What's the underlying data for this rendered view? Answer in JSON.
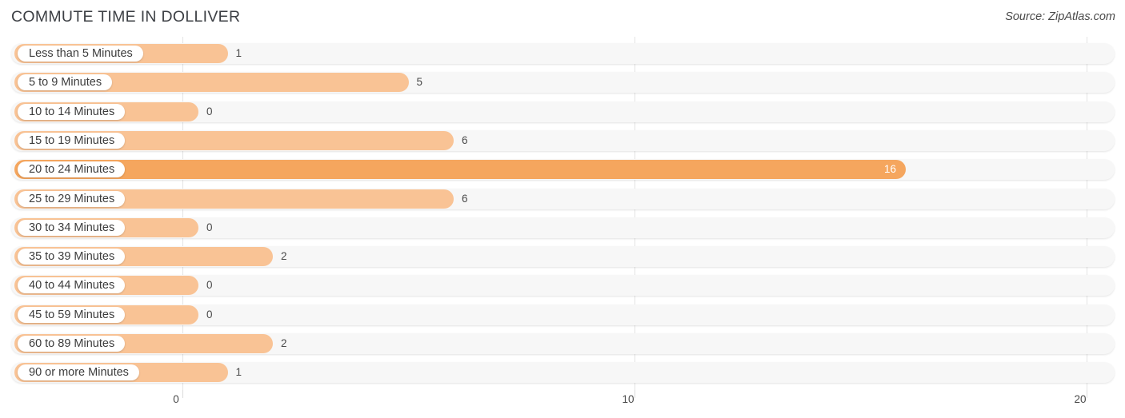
{
  "header": {
    "title": "COMMUTE TIME IN DOLLIVER",
    "source": "Source: ZipAtlas.com"
  },
  "colors": {
    "bar": "#F9C395",
    "bar_max": "#F5A65E",
    "track": "#F7F7F7",
    "gridline": "#E4E4E4",
    "text": "#3C3C3C"
  },
  "chart_data": {
    "type": "bar",
    "orientation": "horizontal",
    "title": "COMMUTE TIME IN DOLLIVER",
    "xlabel": "",
    "ylabel": "",
    "xlim": [
      0,
      20
    ],
    "grid": true,
    "legend": "none",
    "axis_ticks": [
      "0",
      "10",
      "20"
    ],
    "axis_tick_values": [
      0,
      10,
      20
    ],
    "categories": [
      "Less than 5 Minutes",
      "5 to 9 Minutes",
      "10 to 14 Minutes",
      "15 to 19 Minutes",
      "20 to 24 Minutes",
      "25 to 29 Minutes",
      "30 to 34 Minutes",
      "35 to 39 Minutes",
      "40 to 44 Minutes",
      "45 to 59 Minutes",
      "60 to 89 Minutes",
      "90 or more Minutes"
    ],
    "values": [
      1,
      5,
      0,
      6,
      16,
      6,
      0,
      2,
      0,
      0,
      2,
      1
    ],
    "value_labels": [
      "1",
      "5",
      "0",
      "6",
      "16",
      "6",
      "0",
      "2",
      "0",
      "0",
      "2",
      "1"
    ],
    "max_value": 16,
    "max_index": 4
  }
}
